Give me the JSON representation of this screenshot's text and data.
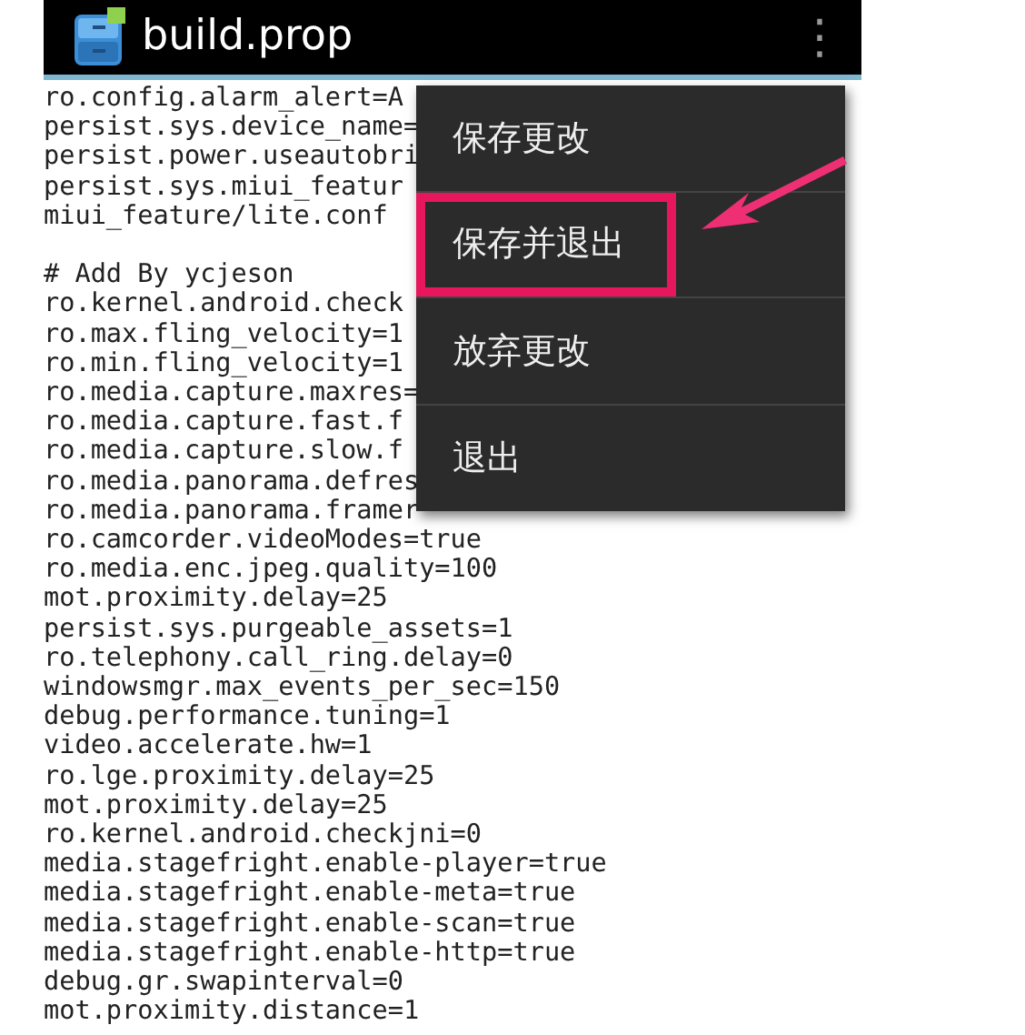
{
  "action_bar": {
    "title": "build.prop",
    "overflow_button": "⋮"
  },
  "lines": [
    {
      "kind": "text",
      "text": "ro.config.alarm_alert=A"
    },
    {
      "kind": "text",
      "text": "persist.sys.device_name="
    },
    {
      "kind": "text",
      "text": "persist.power.useautobri"
    },
    {
      "kind": "text",
      "text": "persist.sys.miui_featur"
    },
    {
      "kind": "text",
      "text": "miui_feature/lite.conf"
    },
    {
      "kind": "blank"
    },
    {
      "kind": "text",
      "text": "# Add By ycjeson"
    },
    {
      "kind": "text",
      "text": "ro.kernel.android.check"
    },
    {
      "kind": "text",
      "text": "ro.max.fling_velocity=1"
    },
    {
      "kind": "text",
      "text": "ro.min.fling_velocity=1"
    },
    {
      "kind": "text",
      "text": "ro.media.capture.maxres="
    },
    {
      "kind": "text",
      "text": "ro.media.capture.fast.f"
    },
    {
      "kind": "text",
      "text": "ro.media.capture.slow.f"
    },
    {
      "kind": "text",
      "text": "ro.media.panorama.defres"
    },
    {
      "kind": "text",
      "text": "ro.media.panorama.framer"
    },
    {
      "kind": "text",
      "text": "ro.camcorder.videoModes=true"
    },
    {
      "kind": "text",
      "text": "ro.media.enc.jpeg.quality=100"
    },
    {
      "kind": "text",
      "text": "mot.proximity.delay=25"
    },
    {
      "kind": "text",
      "text": "persist.sys.purgeable_assets=1"
    },
    {
      "kind": "text",
      "text": "ro.telephony.call_ring.delay=0"
    },
    {
      "kind": "text",
      "text": "windowsmgr.max_events_per_sec=150"
    },
    {
      "kind": "text",
      "text": "debug.performance.tuning=1"
    },
    {
      "kind": "text",
      "text": "video.accelerate.hw=1"
    },
    {
      "kind": "text",
      "text": "ro.lge.proximity.delay=25"
    },
    {
      "kind": "text",
      "text": "mot.proximity.delay=25"
    },
    {
      "kind": "text",
      "text": "ro.kernel.android.checkjni=0"
    },
    {
      "kind": "text",
      "text": "media.stagefright.enable-player=true"
    },
    {
      "kind": "text",
      "text": "media.stagefright.enable-meta=true"
    },
    {
      "kind": "text",
      "text": "media.stagefright.enable-scan=true"
    },
    {
      "kind": "text",
      "text": "media.stagefright.enable-http=true"
    },
    {
      "kind": "text",
      "text": "debug.gr.swapinterval=0"
    },
    {
      "kind": "text",
      "text": "mot.proximity.distance=1"
    }
  ],
  "menu": {
    "items": [
      {
        "label": "保存更改",
        "highlighted": false
      },
      {
        "label": "保存并退出",
        "highlighted": true
      },
      {
        "label": "放弃更改",
        "highlighted": false
      },
      {
        "label": "退出",
        "highlighted": false
      }
    ]
  }
}
